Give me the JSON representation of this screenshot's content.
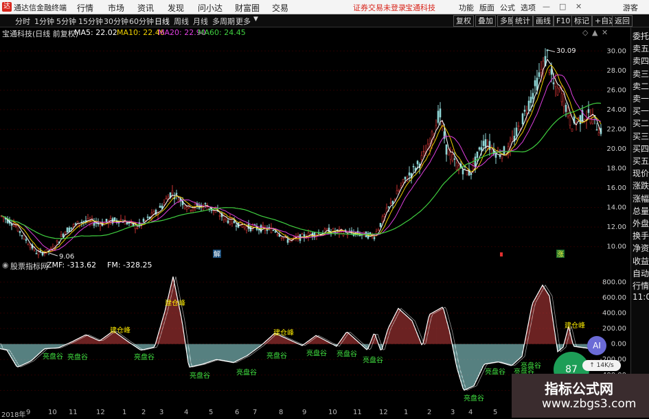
{
  "topbar": {
    "app_name": "通达信金融终端",
    "menus": [
      "行情",
      "市场",
      "资讯",
      "发现",
      "问小达",
      "财富圈",
      "交易"
    ],
    "warning": "证券交易未登录",
    "broker": "宝通科技",
    "right_buttons": [
      "功能",
      "版面",
      "公式",
      "选项"
    ],
    "guest": "游客"
  },
  "toolbar": {
    "periods": [
      "分时",
      "1分钟",
      "5分钟",
      "15分钟",
      "30分钟",
      "60分钟",
      "日线",
      "周线",
      "月线",
      "多周期",
      "更多"
    ],
    "active_period": "日线",
    "right_buttons": [
      "复权",
      "叠加",
      "多股",
      "统计",
      "画线",
      "F10",
      "标记",
      "+自选",
      "返回"
    ]
  },
  "main_chart": {
    "title": "宝通科技(日线 前复权)",
    "ma": [
      {
        "label": "MA5: 22.02",
        "color": "#ffffff"
      },
      {
        "label": "MA10: 22.46",
        "color": "#f0d000"
      },
      {
        "label": "MA20: 22.90",
        "color": "#e040e0"
      },
      {
        "label": "MA60: 24.45",
        "color": "#40d040"
      }
    ],
    "y_ticks": [
      "30.00",
      "28.00",
      "26.00",
      "24.00",
      "22.00",
      "20.00",
      "18.00",
      "16.00",
      "14.00",
      "12.00",
      "10.00"
    ],
    "high_label": "30.09",
    "low_label": "9.06",
    "markers": [
      "解",
      "涨"
    ]
  },
  "sub_chart": {
    "title": "股票指标网",
    "zmf": "ZMF: -313.62",
    "fm": "FM: -328.25",
    "y_ticks": [
      "800.00",
      "600.00",
      "400.00",
      "200.00",
      "0.00",
      "-200.00",
      "-400.00",
      "-600.00"
    ],
    "peak_label": "建仓峰",
    "valley_label": "亮盘谷"
  },
  "sidebar": [
    "委托",
    "卖五",
    "卖四",
    "卖三",
    "卖二",
    "卖一",
    "买一",
    "买二",
    "买三",
    "买四",
    "买五",
    "现价",
    "涨跌",
    "涨幅",
    "总量",
    "外盘",
    "换手",
    "净资",
    "收益",
    "自动",
    "行情",
    "11:0"
  ],
  "x_axis": [
    "2018年",
    "9",
    "10",
    "11",
    "12",
    "1",
    "2",
    "3",
    "4",
    "5",
    "6",
    "7",
    "8",
    "9",
    "10",
    "11",
    "12",
    "1",
    "2",
    "3",
    "4",
    "5",
    "6"
  ],
  "overlay": {
    "bubble_value": "87",
    "pill_text": "↑ 14K/s",
    "ai_label": "AI"
  },
  "watermark": {
    "title": "指标公式网",
    "url": "www.zbgs3.com"
  },
  "colors": {
    "up": "#c83232",
    "down": "#8fd6d6",
    "ma5": "#ffffff",
    "ma10": "#f0d000",
    "ma20": "#e040e0",
    "ma60": "#40d040",
    "accent_red": "#d8261c"
  }
}
